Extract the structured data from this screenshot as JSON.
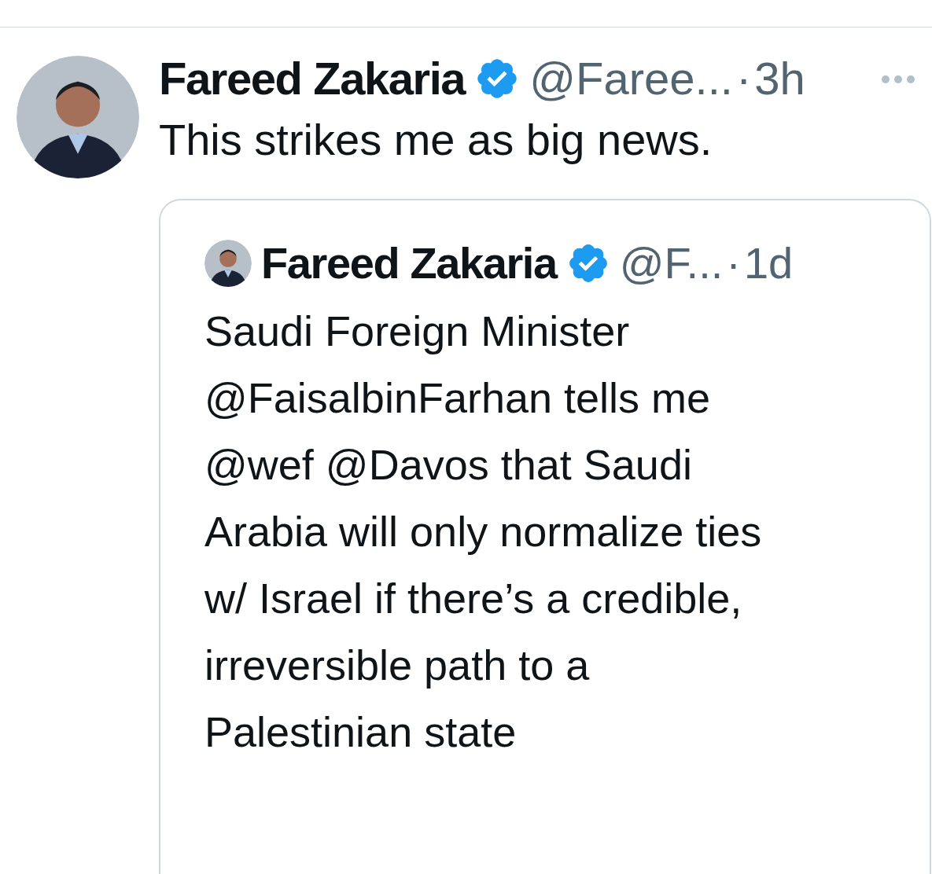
{
  "tweet": {
    "author": {
      "name": "Fareed Zakaria",
      "verified": true,
      "handle": "@Faree...",
      "separator": "·",
      "time": "3h"
    },
    "text": "This strikes me as big news.",
    "quote": {
      "author": {
        "name": "Fareed Zakaria",
        "verified": true,
        "handle": "@F...",
        "separator": "·",
        "time": "1d"
      },
      "lines": [
        "Saudi Foreign Minister",
        "@FaisalbinFarhan tells me",
        "@wef @Davos that Saudi",
        "Arabia will only normalize ties",
        "w/ Israel if there’s a credible,",
        "irreversible path to a",
        "Palestinian state"
      ]
    }
  }
}
